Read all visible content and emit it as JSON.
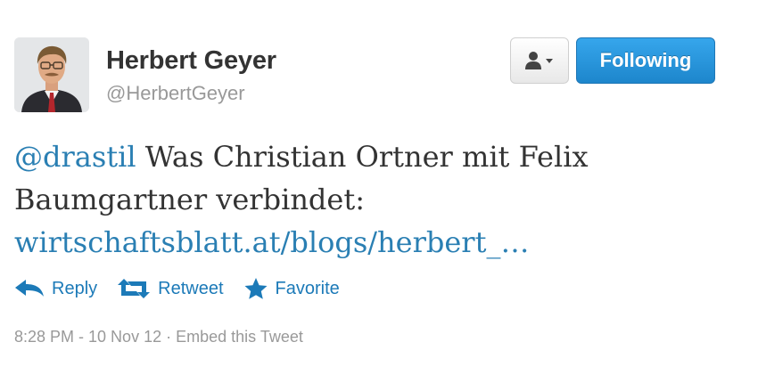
{
  "user": {
    "name": "Herbert Geyer",
    "screen_name": "@HerbertGeyer",
    "avatar_icon": "profile-photo"
  },
  "buttons": {
    "user_dropdown_icon": "person-dropdown-icon",
    "follow_label": "Following"
  },
  "tweet": {
    "mention": "@drastil",
    "text": " Was Christian Ortner mit Felix Baumgartner verbindet: ",
    "link": "wirtschaftsblatt.at/blogs/herbert_…"
  },
  "actions": [
    {
      "label": "Reply",
      "icon": "reply-icon"
    },
    {
      "label": "Retweet",
      "icon": "retweet-icon"
    },
    {
      "label": "Favorite",
      "icon": "star-icon"
    }
  ],
  "meta": {
    "timestamp": "8:28 PM - 10 Nov 12",
    "separator": " · ",
    "embed": "Embed this Tweet"
  },
  "colors": {
    "link": "#2a7fb3",
    "action": "#1c7ab8",
    "follow_button": "#2496de",
    "muted": "#999999"
  }
}
